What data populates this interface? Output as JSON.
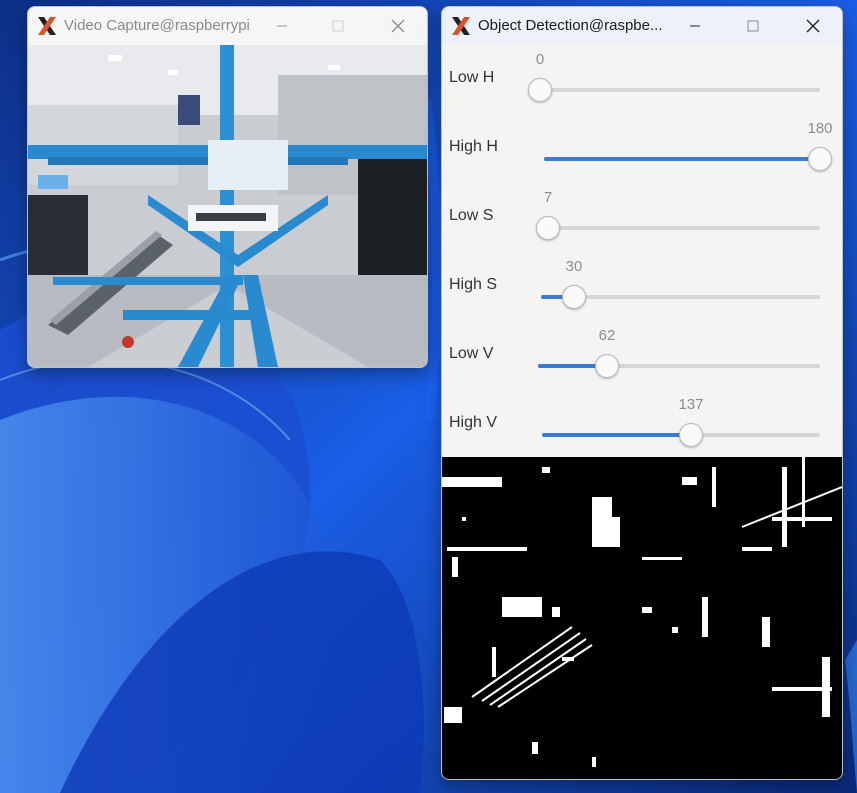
{
  "video_window": {
    "title": "Video Capture@raspberrypi",
    "icon": "x11-icon"
  },
  "detect_window": {
    "title": "Object Detection@raspbe...",
    "icon": "x11-icon",
    "sliders": [
      {
        "label": "Low H",
        "value": "0",
        "fraction": 0.0
      },
      {
        "label": "High H",
        "value": "180",
        "fraction": 1.0
      },
      {
        "label": "Low S",
        "value": "7",
        "fraction": 0.027
      },
      {
        "label": "High S",
        "value": "30",
        "fraction": 0.118
      },
      {
        "label": "Low V",
        "value": "62",
        "fraction": 0.243
      },
      {
        "label": "High V",
        "value": "137",
        "fraction": 0.537
      }
    ]
  },
  "colors": {
    "accent": "#3a7bd5",
    "wallpaper": "#0a3aa8"
  }
}
